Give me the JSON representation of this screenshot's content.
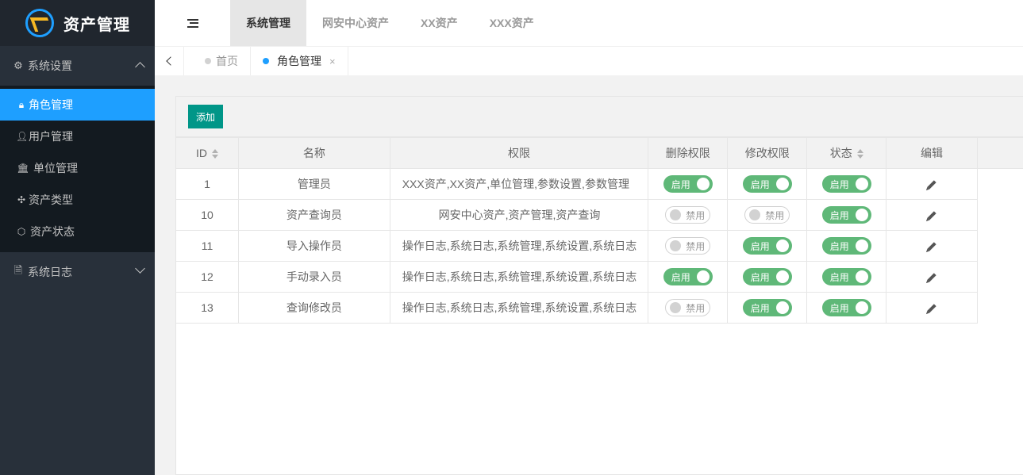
{
  "app": {
    "title": "资产管理"
  },
  "sidebar": {
    "groups": [
      {
        "label": "系统设置",
        "icon": "gears-icon",
        "expanded": true,
        "items": [
          {
            "label": "角色管理",
            "icon": "lock-icon",
            "active": true
          },
          {
            "label": "用户管理",
            "icon": "user-icon"
          },
          {
            "label": "单位管理",
            "icon": "bank-icon"
          },
          {
            "label": "资产类型",
            "icon": "puzzle-icon"
          },
          {
            "label": "资产状态",
            "icon": "cube-icon"
          }
        ]
      },
      {
        "label": "系统日志",
        "icon": "file-icon",
        "expanded": false
      }
    ]
  },
  "header": {
    "tabs": [
      {
        "label": "系统管理",
        "active": true
      },
      {
        "label": "网安中心资产"
      },
      {
        "label": "XX资产"
      },
      {
        "label": "XXX资产"
      }
    ]
  },
  "pagetabs": [
    {
      "label": "首页"
    },
    {
      "label": "角色管理",
      "active": true,
      "close": "×"
    }
  ],
  "toolbar": {
    "add_label": "添加"
  },
  "table": {
    "columns": [
      "ID",
      "名称",
      "权限",
      "删除权限",
      "修改权限",
      "状态",
      "编辑"
    ],
    "on_label": "启用",
    "off_label": "禁用",
    "rows": [
      {
        "id": "1",
        "name": "管理员",
        "perm": "XXX资产,XX资产,单位管理,参数设置,参数管理",
        "del": true,
        "mod": true,
        "status": true
      },
      {
        "id": "10",
        "name": "资产查询员",
        "perm": "网安中心资产,资产管理,资产查询",
        "del": false,
        "mod": false,
        "status": true
      },
      {
        "id": "11",
        "name": "导入操作员",
        "perm": "操作日志,系统日志,系统管理,系统设置,系统日志",
        "del": false,
        "mod": true,
        "status": true
      },
      {
        "id": "12",
        "name": "手动录入员",
        "perm": "操作日志,系统日志,系统管理,系统设置,系统日志",
        "del": true,
        "mod": true,
        "status": true
      },
      {
        "id": "13",
        "name": "查询修改员",
        "perm": "操作日志,系统日志,系统管理,系统设置,系统日志",
        "del": false,
        "mod": true,
        "status": true
      }
    ]
  },
  "colors": {
    "accent": "#1e9fff",
    "switch_on": "#5fb878",
    "add_button": "#009688",
    "sidebar_bg": "#28303a"
  }
}
